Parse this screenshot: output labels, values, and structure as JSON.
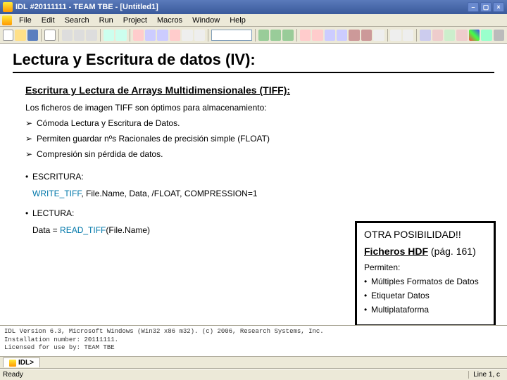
{
  "titlebar": {
    "text": "IDL #20111111 - TEAM TBE - [Untitled1]"
  },
  "menu": {
    "file": "File",
    "edit": "Edit",
    "search": "Search",
    "run": "Run",
    "project": "Project",
    "macros": "Macros",
    "window": "Window",
    "help": "Help"
  },
  "slide": {
    "title": "Lectura y Escritura de datos (IV):",
    "subhead": "Escritura y Lectura de Arrays Multidimensionales (TIFF):",
    "intro": "Los ficheros de imagen TIFF son óptimos para almacenamiento:",
    "b1": "Cómoda Lectura y Escritura de Datos.",
    "b2": "Permiten guardar nºs Racionales de precisión simple (FLOAT)",
    "b3": "Compresión sin pérdida de datos.",
    "esc_label": "ESCRITURA:",
    "write_cmd_kw": "WRITE_TIFF",
    "write_cmd_rest": ", File.Name, Data, /FLOAT, COMPRESSION=1",
    "lec_label": "LECTURA:",
    "read_cmd_pre": "Data = ",
    "read_cmd_kw": "READ_TIFF",
    "read_cmd_rest": "(File.Name)"
  },
  "infobox": {
    "title": "OTRA POSIBILIDAD!!",
    "main_bold": "Ficheros HDF",
    "main_rest": " (pág. 161)",
    "permit": "Permiten:",
    "li1": "Múltiples Formatos de Datos",
    "li2": "Etiquetar Datos",
    "li3": "Multiplataforma"
  },
  "console": {
    "l1": "IDL Version 6.3, Microsoft Windows (Win32 x86 m32). (c) 2006, Research Systems, Inc.",
    "l2": "Installation number: 20111111.",
    "l3": "Licensed for use by: TEAM TBE"
  },
  "tab": {
    "label": "IDL>"
  },
  "status": {
    "ready": "Ready",
    "line": "Line 1, c"
  }
}
